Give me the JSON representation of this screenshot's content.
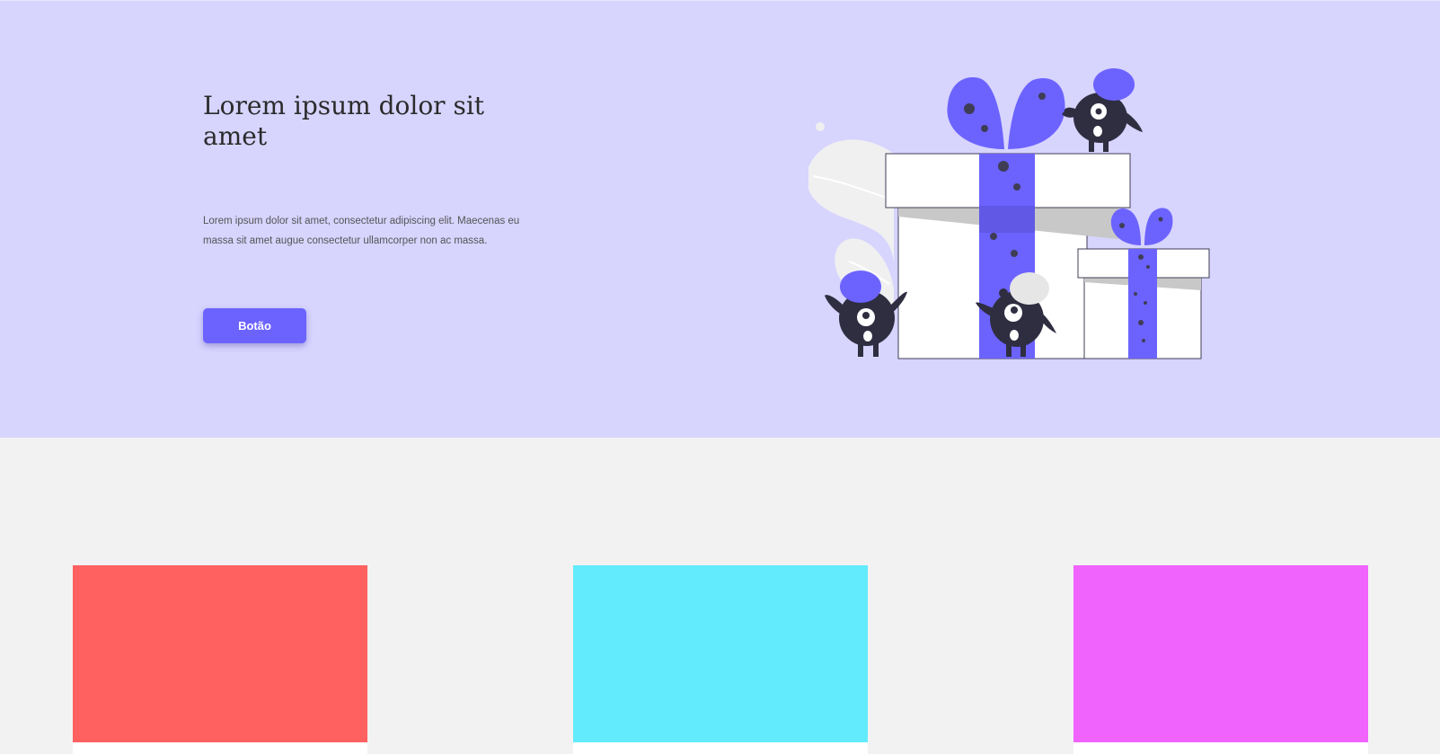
{
  "hero": {
    "title": "Lorem ipsum dolor sit amet",
    "text": "Lorem ipsum dolor sit amet, consectetur adipiscing elit. Maecenas eu massa sit amet augue consectetur ullamcorper non ac massa.",
    "button_label": "Botão",
    "illustration_icon": "gift-boxes-with-monsters-illustration"
  },
  "colors": {
    "hero_bg": "#d7d4fe",
    "accent": "#6c63ff",
    "page_bg": "#f2f2f2",
    "card_1": "#ff6160",
    "card_2": "#62ebfc",
    "card_3": "#f163fd"
  },
  "cards": [
    {
      "color": "#ff6160"
    },
    {
      "color": "#62ebfc"
    },
    {
      "color": "#f163fd"
    }
  ]
}
